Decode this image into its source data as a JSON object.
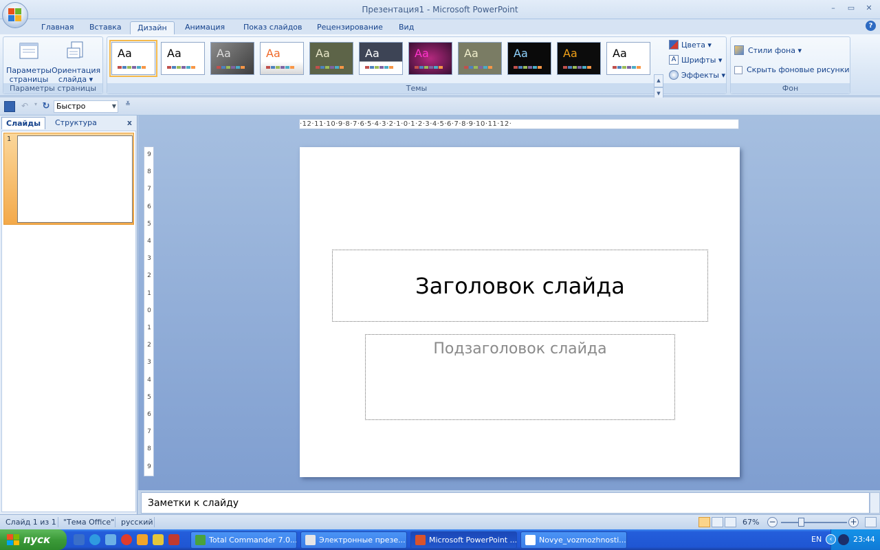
{
  "window": {
    "title": "Презентация1 - Microsoft PowerPoint",
    "controls": [
      "–",
      "▭",
      "✕"
    ]
  },
  "ribbon_tabs": [
    "Главная",
    "Вставка",
    "Дизайн",
    "Анимация",
    "Показ слайдов",
    "Рецензирование",
    "Вид"
  ],
  "active_tab": "Дизайн",
  "groups": {
    "page_setup": {
      "label": "Параметры страницы",
      "params_btn": [
        "Параметры",
        "страницы"
      ],
      "orient_btn": [
        "Ориентация",
        "слайда ▾"
      ]
    },
    "themes": {
      "label": "Темы",
      "thumb_text": "Aa",
      "colors": "Цвета ▾",
      "fonts": "Шрифты ▾",
      "effects": "Эффекты ▾"
    },
    "background": {
      "label": "Фон",
      "styles": "Стили фона ▾",
      "hide_graphics": "Скрыть фоновые рисунки"
    }
  },
  "qat": {
    "combo_value": "Быстро"
  },
  "left_pane": {
    "tab_slides": "Слайды",
    "tab_outline": "Структура",
    "close": "x",
    "slide_number": "1"
  },
  "ruler": {
    "horizontal": "·12·11·10·9·8·7·6·5·4·3·2·1·0·1·2·3·4·5·6·7·8·9·10·11·12·",
    "vertical": [
      "9",
      "8",
      "7",
      "6",
      "5",
      "4",
      "3",
      "2",
      "1",
      "0",
      "1",
      "2",
      "3",
      "4",
      "5",
      "6",
      "7",
      "8",
      "9"
    ]
  },
  "slide": {
    "title_placeholder": "Заголовок слайда",
    "subtitle_placeholder": "Подзаголовок слайда"
  },
  "notes": {
    "placeholder": "Заметки к слайду"
  },
  "status": {
    "slide_counter": "Слайд 1 из 1",
    "theme": "\"Тема Office\"",
    "language": "русский",
    "zoom": "67%"
  },
  "taskbar": {
    "start": "пуск",
    "tasks": [
      {
        "label": "Total Commander 7.0...",
        "color": "#4aa23c"
      },
      {
        "label": "Электронные презе...",
        "color": "#e6e6e6"
      },
      {
        "label": "Microsoft PowerPoint ...",
        "color": "#d9532c"
      },
      {
        "label": "Novye_vozmozhnosti...",
        "color": "#ffffff"
      }
    ],
    "active_task_index": 2,
    "lang": "EN",
    "clock": "23:44"
  },
  "colors": {
    "ribbon_text": "#15428b",
    "selected_theme": "#f6b94a",
    "slide_bg": "#ffffff",
    "taskbar": "#245edb"
  }
}
